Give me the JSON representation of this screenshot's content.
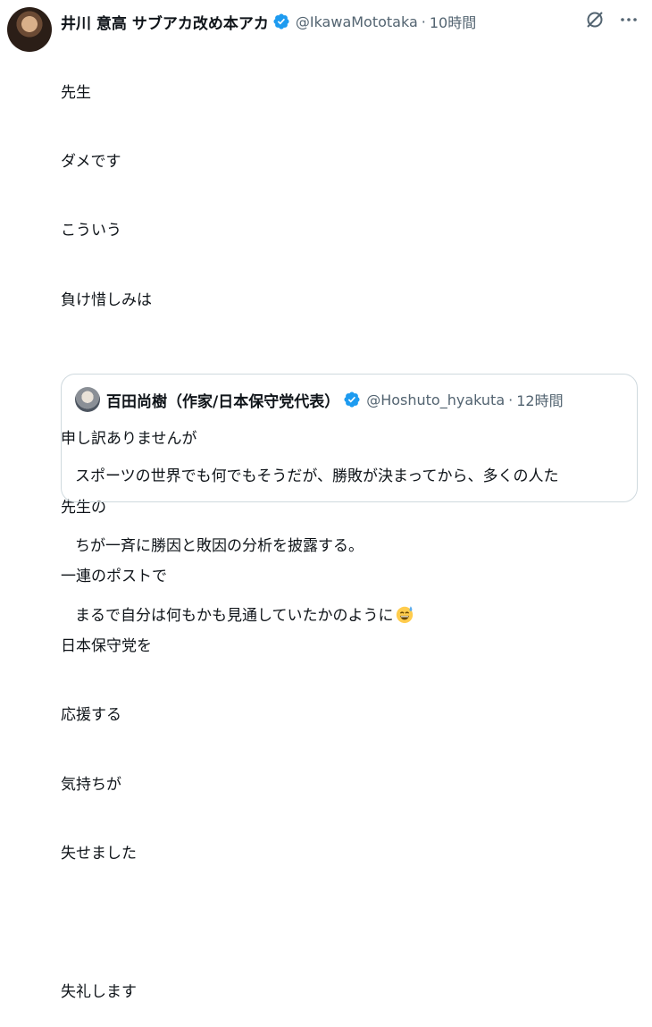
{
  "tweet": {
    "author": {
      "name": "井川 意高 サブアカ改め本アカ",
      "handle": "@IkawaMototaka",
      "time": "10時間"
    },
    "separator": "·",
    "lines": [
      "先生",
      "ダメです",
      "こういう",
      "負け惜しみは",
      "",
      "申し訳ありませんが",
      "先生の",
      "一連のポストで",
      "日本保守党を",
      "応援する",
      "気持ちが",
      "失せました",
      "",
      "失礼します"
    ]
  },
  "quote": {
    "author": {
      "name": "百田尚樹（作家/日本保守党代表）",
      "handle": "@Hoshuto_hyakuta",
      "time": "12時間"
    },
    "separator": "·",
    "lines": [
      "スポーツの世界でも何でもそうだが、勝敗が決まってから、多くの人た",
      "ちが一斉に勝因と敗因の分析を披露する。",
      "まるで自分は何もかも見通していたかのように"
    ],
    "emoji": "sweat-smile-emoji"
  },
  "icons": {
    "verified": "verified-badge-icon",
    "grok": "grok-icon",
    "more": "more-icon"
  },
  "colors": {
    "verified": "#1d9bf0",
    "secondary_text": "#536471",
    "border": "#cfd9de"
  }
}
